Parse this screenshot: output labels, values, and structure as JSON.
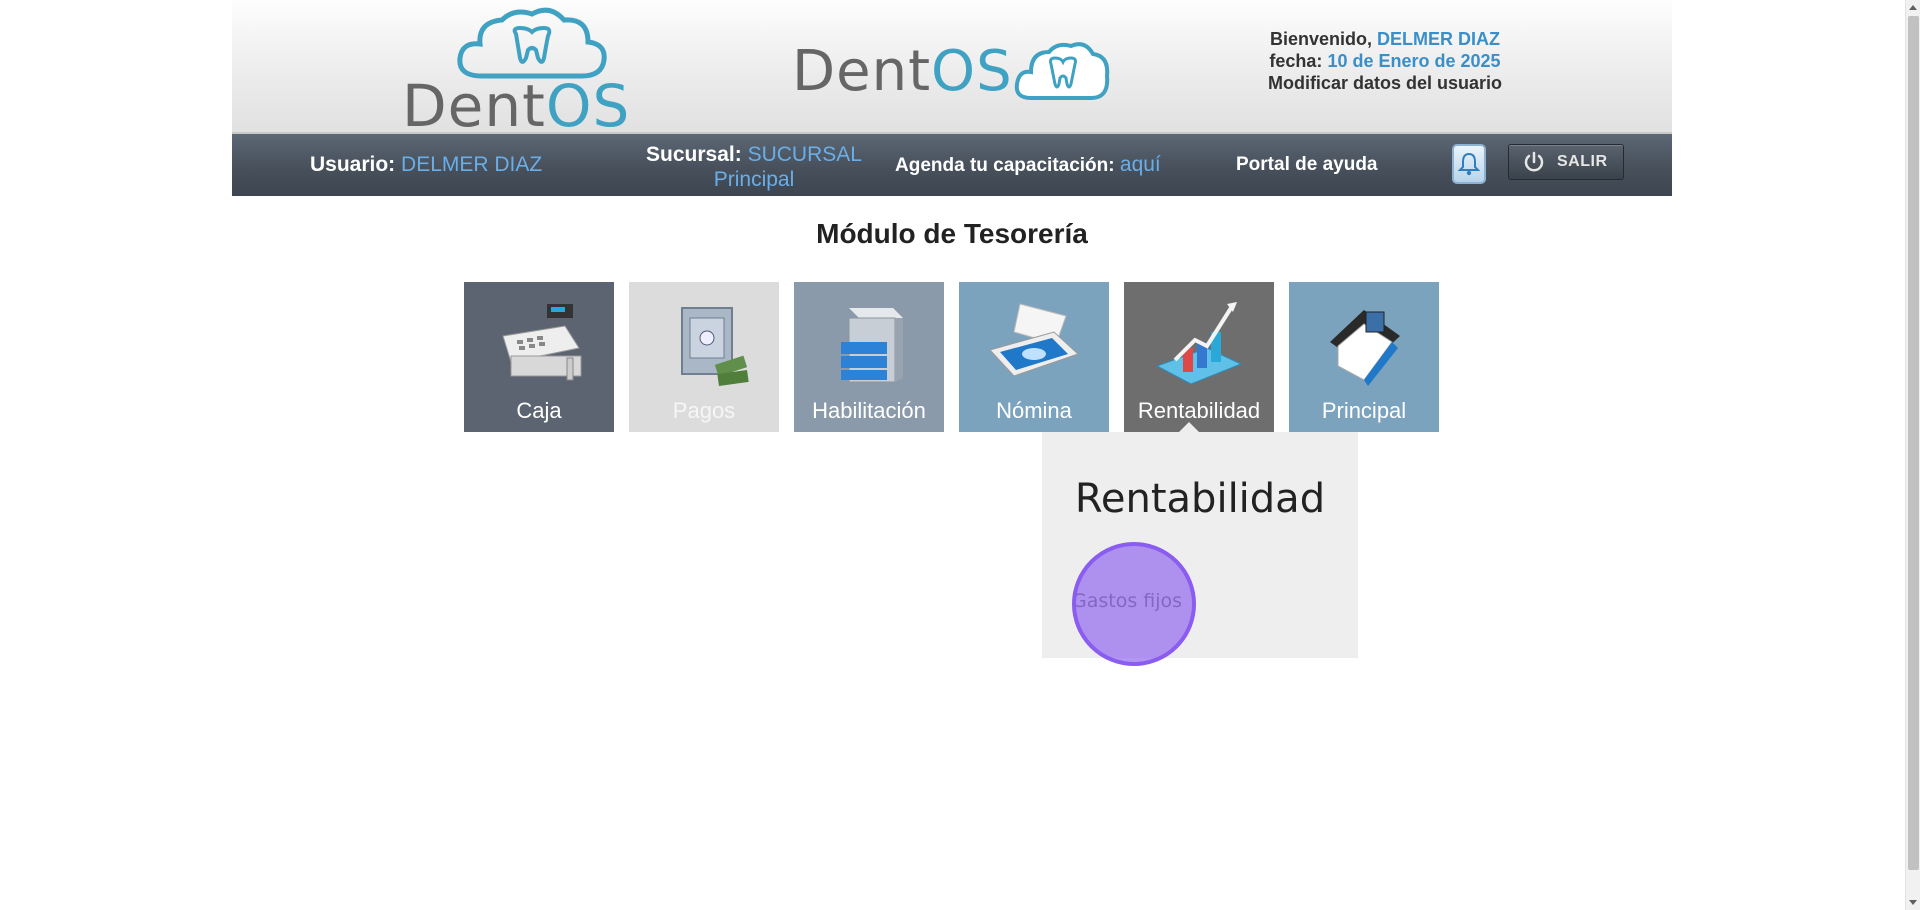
{
  "header": {
    "logo_left": {
      "dent": "Dent",
      "os": "OS"
    },
    "logo_center": {
      "dent": "Dent",
      "os": "OS"
    },
    "welcome_label": "Bienvenido,",
    "welcome_name": "DELMER DIAZ",
    "date_label": "fecha:",
    "date_value": "10 de Enero de 2025",
    "modify_link": "Modificar datos del usuario"
  },
  "navbar": {
    "usuario_label": "Usuario:",
    "usuario_value": "DELMER DIAZ",
    "sucursal_label": "Sucursal:",
    "sucursal_value_1": "SUCURSAL",
    "sucursal_value_2": "Principal",
    "agenda_label": "Agenda tu capacitación:",
    "agenda_link": "aquí",
    "portal_link": "Portal de ayuda",
    "salir_label": "SALIR"
  },
  "main": {
    "title": "Módulo de Tesorería",
    "tiles": [
      {
        "label": "Caja"
      },
      {
        "label": "Pagos"
      },
      {
        "label": "Habilitación"
      },
      {
        "label": "Nómina"
      },
      {
        "label": "Rentabilidad"
      },
      {
        "label": "Principal"
      }
    ]
  },
  "popup": {
    "title": "Rentabilidad",
    "items": [
      {
        "label": "Gastos fijos"
      }
    ]
  },
  "colors": {
    "nav_bg": "#47505b",
    "link_blue": "#6aaee8",
    "brand_teal": "#3fa2c2",
    "highlight": "#966ef0"
  }
}
